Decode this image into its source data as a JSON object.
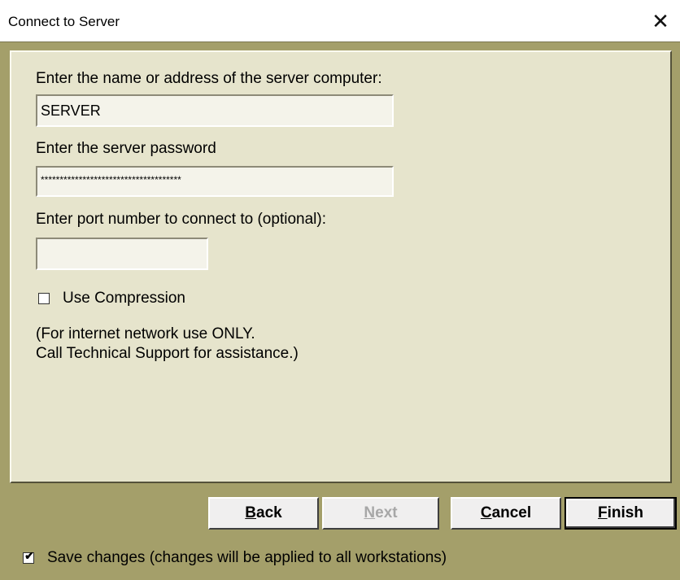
{
  "window": {
    "title": "Connect to Server",
    "close_glyph": "✕"
  },
  "form": {
    "server_label": "Enter the name or address of the server computer:",
    "server_value": "SERVER",
    "password_label": "Enter the server password",
    "password_value": "*************************************",
    "port_label": "Enter port number to connect to (optional):",
    "port_value": "",
    "compression_label": "Use Compression",
    "compression_checked": false,
    "note_line1": "(For internet network use ONLY.",
    "note_line2": "Call Technical Support for assistance.)"
  },
  "buttons": {
    "back": {
      "mnemonic": "B",
      "rest": "ack",
      "enabled": true
    },
    "next": {
      "mnemonic": "N",
      "rest": "ext",
      "enabled": false
    },
    "cancel": {
      "mnemonic": "C",
      "rest": "ancel",
      "enabled": true
    },
    "finish": {
      "mnemonic": "F",
      "rest": "inish",
      "enabled": true
    }
  },
  "footer": {
    "save_label": "Save changes (changes will be applied to all workstations)",
    "save_checked": true,
    "check_glyph": "✔"
  },
  "colors": {
    "frame": "#a49f6a",
    "panel": "#e6e4cc",
    "field": "#f4f3ea",
    "button_face": "#f0efef",
    "disabled_text": "#a7a7a7"
  },
  "icons": [
    "close-icon",
    "check-icon"
  ]
}
